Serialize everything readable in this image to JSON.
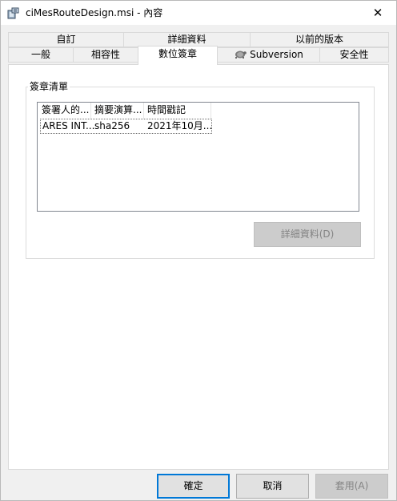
{
  "window": {
    "title": "ciMesRouteDesign.msi - 內容",
    "title_icon": "msi-package-icon",
    "close_glyph": "✕"
  },
  "tabs": {
    "back_row": [
      "自訂",
      "詳細資料",
      "以前的版本"
    ],
    "front_row": [
      "一般",
      "相容性",
      "數位簽章",
      "Subversion",
      "安全性"
    ],
    "active": "數位簽章",
    "subversion_icon": "tortoise-svn-icon"
  },
  "signature_list": {
    "group_label": "簽章清單",
    "columns": [
      "簽署人的...",
      "摘要演算...",
      "時間戳記"
    ],
    "rows": [
      [
        "ARES INT...",
        "sha256",
        "2021年10月..."
      ]
    ],
    "details_button": "詳細資料(D)"
  },
  "footer": {
    "ok": "確定",
    "cancel": "取消",
    "apply": "套用(A)"
  },
  "colors": {
    "accent": "#0078d7",
    "disabled_button": "#cccccc",
    "disabled_text": "#838383",
    "dialog_bg": "#f0f0f0"
  }
}
